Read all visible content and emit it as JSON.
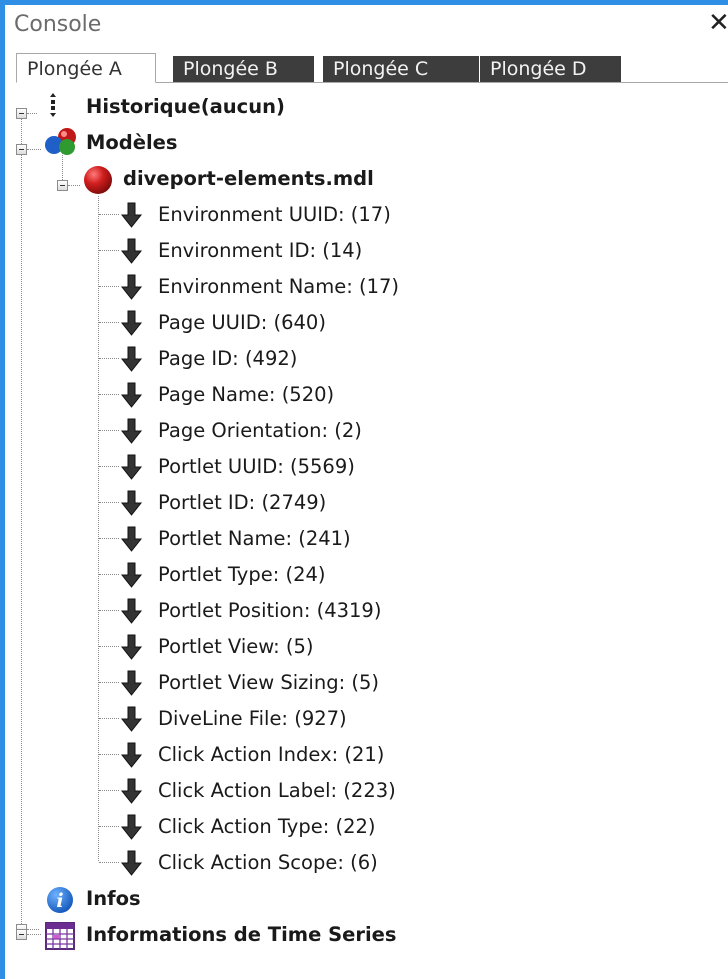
{
  "window": {
    "title": "Console",
    "close_glyph": "✕"
  },
  "tabs": [
    {
      "label": "Plongée A",
      "active": true
    },
    {
      "label": "Plongée B",
      "active": false
    },
    {
      "label": "Plongée C",
      "active": false
    },
    {
      "label": "Plongée D",
      "active": false
    }
  ],
  "tree": {
    "historique": {
      "label": "Historique(aucun)",
      "icon": "ellipsis-vertical-icon"
    },
    "modeles": {
      "label": "Modèles",
      "icon": "model-spheres-icon"
    },
    "model_file": {
      "label": "diveport-elements.mdl",
      "icon": "red-sphere-icon"
    },
    "fields": [
      {
        "label": "Environment UUID: (17)"
      },
      {
        "label": "Environment ID: (14)"
      },
      {
        "label": "Environment Name: (17)"
      },
      {
        "label": "Page UUID: (640)"
      },
      {
        "label": "Page ID: (492)"
      },
      {
        "label": "Page Name: (520)"
      },
      {
        "label": "Page Orientation: (2)"
      },
      {
        "label": "Portlet UUID: (5569)"
      },
      {
        "label": "Portlet ID: (2749)"
      },
      {
        "label": "Portlet Name: (241)"
      },
      {
        "label": "Portlet Type: (24)"
      },
      {
        "label": "Portlet Position: (4319)"
      },
      {
        "label": "Portlet View: (5)"
      },
      {
        "label": "Portlet View Sizing: (5)"
      },
      {
        "label": "DiveLine File: (927)"
      },
      {
        "label": "Click Action Index: (21)"
      },
      {
        "label": "Click Action Label: (223)"
      },
      {
        "label": "Click Action Type: (22)"
      },
      {
        "label": "Click Action Scope: (6)"
      }
    ],
    "infos": {
      "label": "Infos",
      "icon": "info-icon"
    },
    "time_series": {
      "label": "Informations de Time Series",
      "icon": "calendar-grid-icon"
    }
  }
}
